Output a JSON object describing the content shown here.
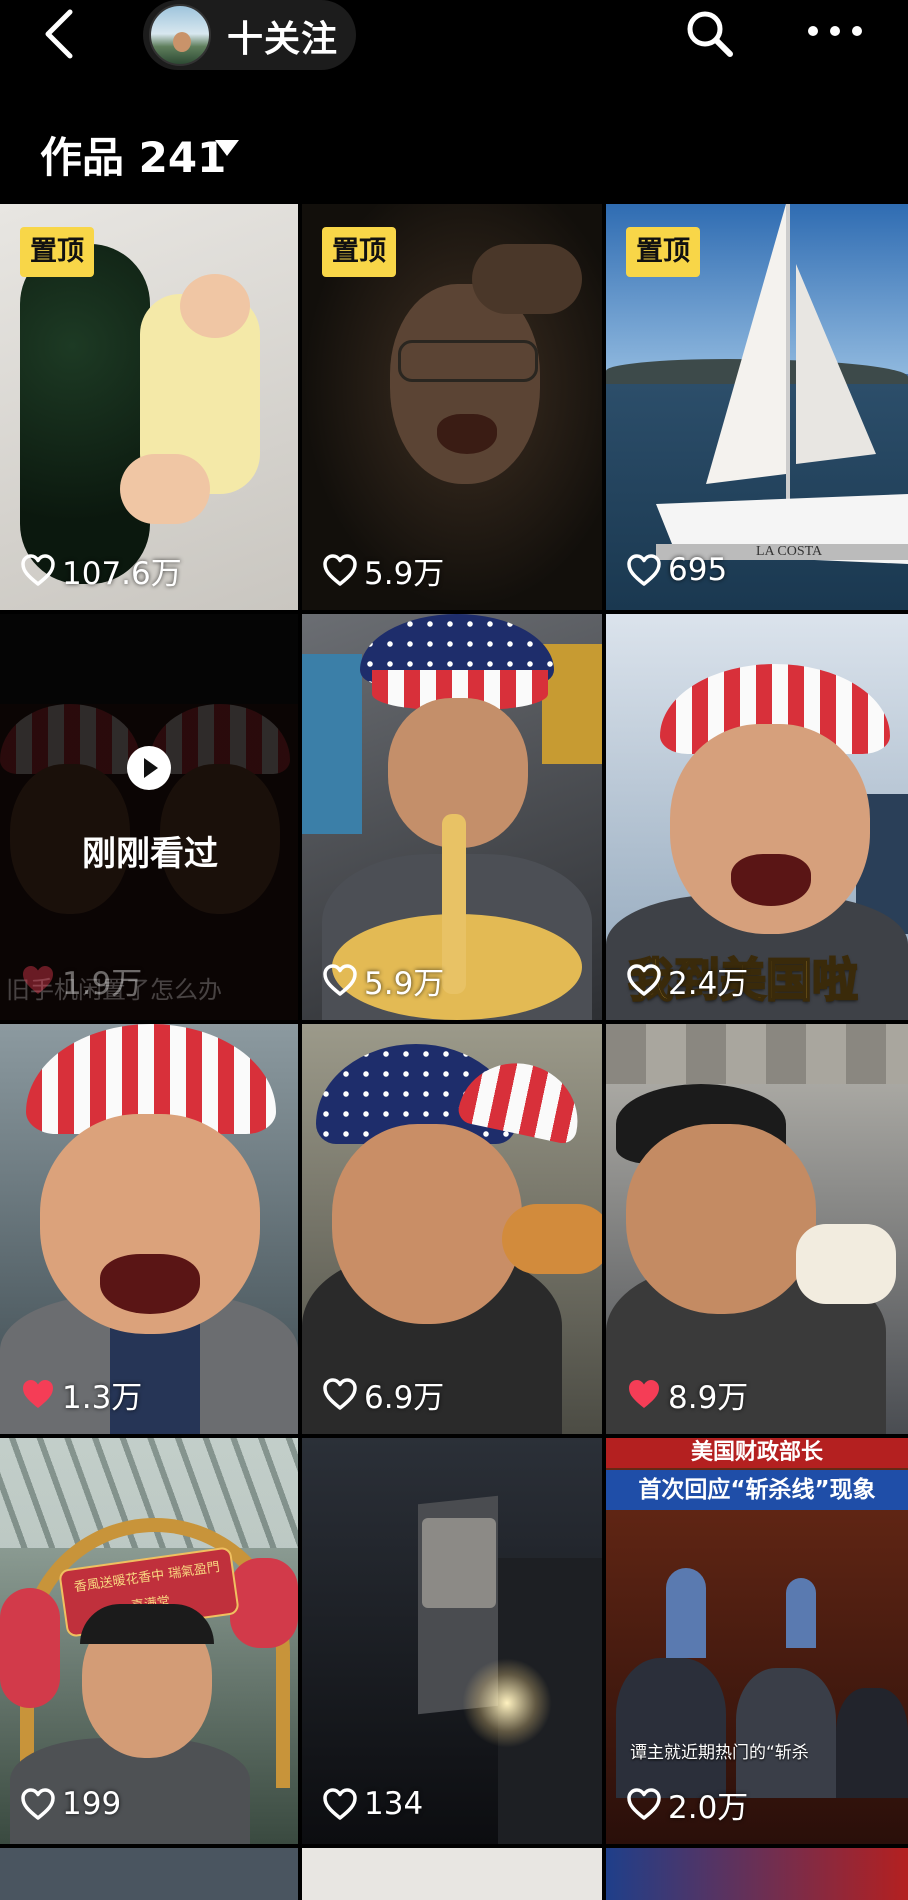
{
  "header": {
    "follow_label": "十关注",
    "works_title": "作品 241",
    "icons": {
      "back": "back-chevron-icon",
      "search": "search-icon",
      "more": "more-dots-icon",
      "caret": "caret-down-icon"
    }
  },
  "colors": {
    "background": "#000000",
    "pin_badge": "#f8d648",
    "liked_heart": "#f53d56",
    "unliked_heart": "#ffffff"
  },
  "grid": {
    "pinned_label": "置顶",
    "recently_watched_label": "刚刚看过",
    "tiles": [
      {
        "id": "t1",
        "likes": "107.6万",
        "liked": false,
        "pinned": true
      },
      {
        "id": "t2",
        "likes": "5.9万",
        "liked": false,
        "pinned": true
      },
      {
        "id": "t3",
        "likes": "695",
        "liked": false,
        "pinned": true,
        "boat_name": "LA COSTA"
      },
      {
        "id": "t4",
        "likes": "1.9万",
        "liked": true,
        "pinned": false,
        "recently_watched": true,
        "caption": "旧手机闲置了怎么办"
      },
      {
        "id": "t5",
        "likes": "5.9万",
        "liked": false,
        "pinned": false
      },
      {
        "id": "t6",
        "likes": "2.4万",
        "liked": false,
        "pinned": false,
        "overlay_text": "我到美国啦"
      },
      {
        "id": "t7",
        "likes": "1.3万",
        "liked": true,
        "pinned": false
      },
      {
        "id": "t8",
        "likes": "6.9万",
        "liked": false,
        "pinned": false
      },
      {
        "id": "t9",
        "likes": "8.9万",
        "liked": true,
        "pinned": false
      },
      {
        "id": "t10",
        "likes": "199",
        "liked": false,
        "pinned": false,
        "arch_text": "香風送暖花香中 瑞氣盈門喜满堂"
      },
      {
        "id": "t11",
        "likes": "134",
        "liked": false,
        "pinned": false
      },
      {
        "id": "t12",
        "likes": "2.0万",
        "liked": false,
        "pinned": false,
        "headline_top": "美国财政部长",
        "headline_bottom": "首次回应“斩杀线”现象",
        "subtitle": "谭主就近期热门的“斩杀"
      }
    ]
  }
}
